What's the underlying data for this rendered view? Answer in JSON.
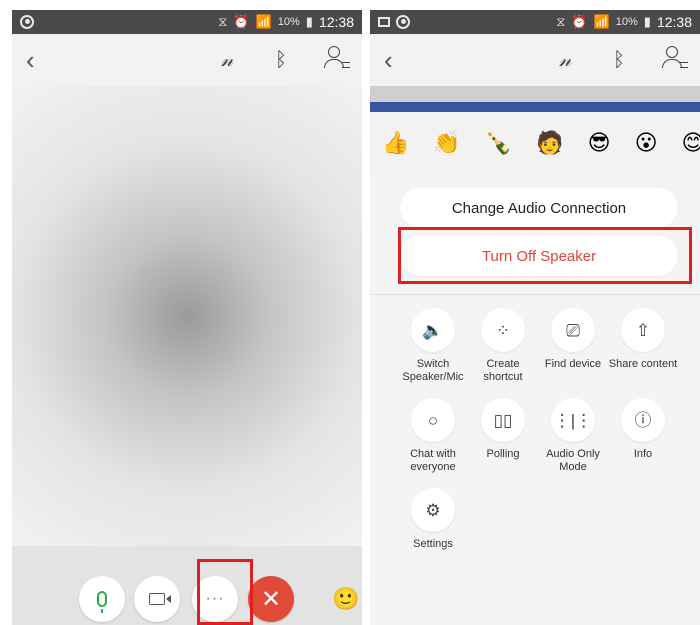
{
  "status_bar": {
    "battery": "10%",
    "time": "12:38"
  },
  "header": {
    "back_icon": "chevron-left-icon",
    "icons": [
      "annotate-icon",
      "bluetooth-icon",
      "participants-icon"
    ]
  },
  "left_screen": {
    "controls": [
      {
        "name": "mute-button",
        "icon": "microphone-icon"
      },
      {
        "name": "video-button",
        "icon": "camera-icon"
      },
      {
        "name": "more-options-button",
        "icon": "ellipsis-icon",
        "label": "···"
      },
      {
        "name": "end-call-button",
        "icon": "close-icon",
        "label": "✕"
      },
      {
        "name": "reactions-button",
        "icon": "emoji-icon"
      }
    ]
  },
  "right_screen": {
    "reactions": [
      "👍",
      "👏",
      "🍾",
      "🧑",
      "😎",
      "😮",
      "😊"
    ],
    "change_audio_label": "Change Audio Connection",
    "turn_off_speaker_label": "Turn Off Speaker",
    "menu_items": [
      {
        "label": "Switch\nSpeaker/Mic",
        "icon": "speaker-icon",
        "glyph": "🔈"
      },
      {
        "label": "Create\nshortcut",
        "icon": "grid-icon",
        "glyph": "⁘"
      },
      {
        "label": "Find device",
        "icon": "cast-icon",
        "glyph": "⎚"
      },
      {
        "label": "Share content",
        "icon": "share-icon",
        "glyph": "⇧"
      },
      {
        "label": "Chat with\neveryone",
        "icon": "chat-icon",
        "glyph": "○"
      },
      {
        "label": "Polling",
        "icon": "polling-icon",
        "glyph": "▯▯"
      },
      {
        "label": "Audio Only\nMode",
        "icon": "audio-wave-icon",
        "glyph": "⋮|⋮"
      },
      {
        "label": "Info",
        "icon": "info-icon",
        "glyph": "ⓘ"
      },
      {
        "label": "Settings",
        "icon": "gear-icon",
        "glyph": "⚙"
      }
    ]
  }
}
